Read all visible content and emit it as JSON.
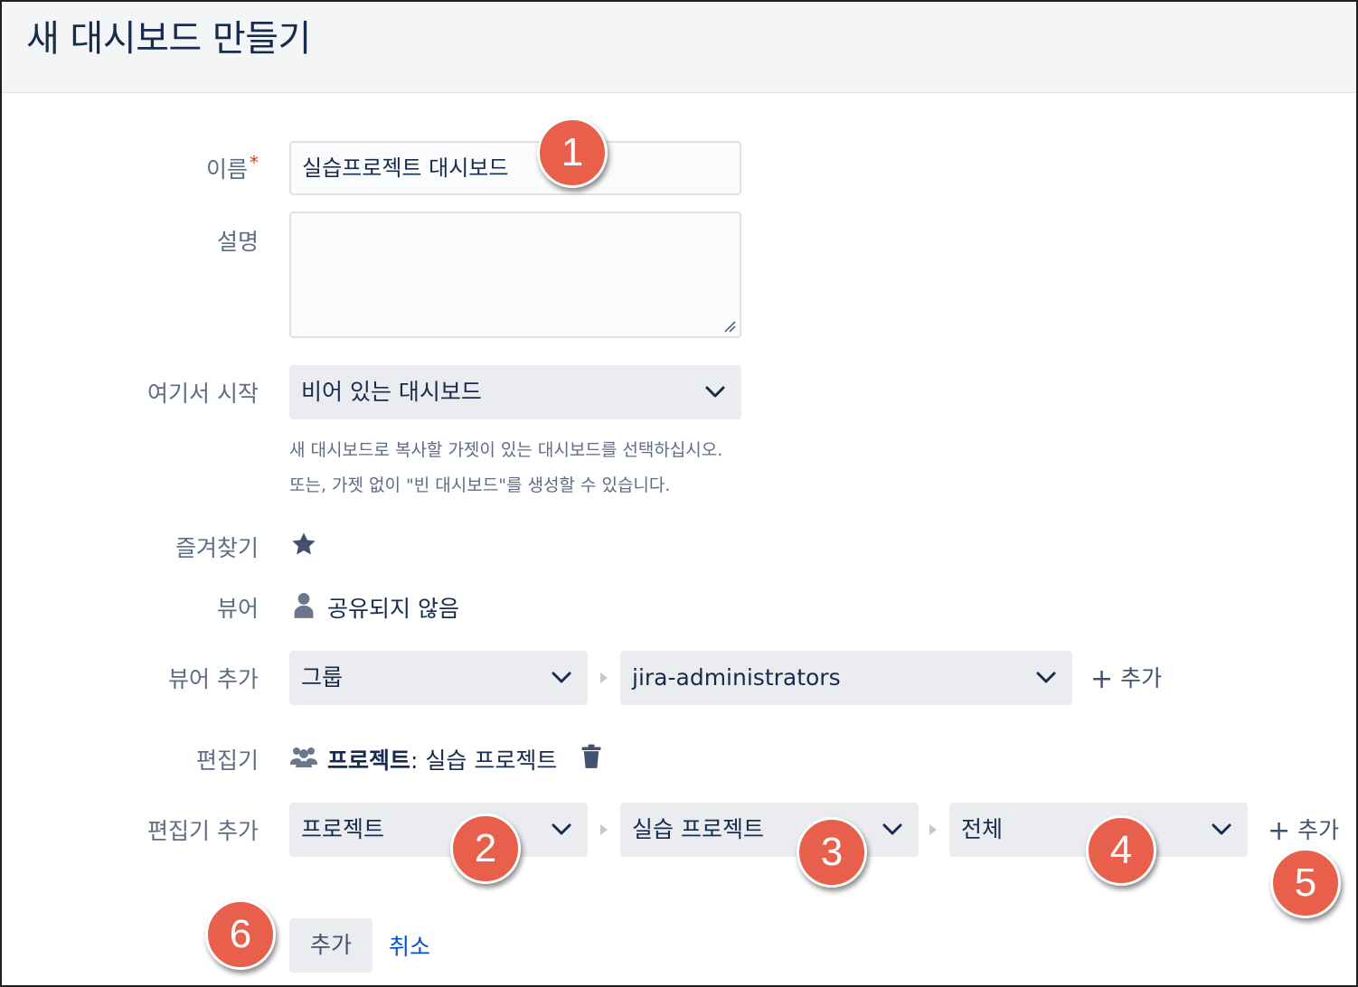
{
  "header": {
    "title": "새 대시보드 만들기"
  },
  "form": {
    "name": {
      "label": "이름",
      "required_mark": "*",
      "value": "실습프로젝트 대시보드"
    },
    "description": {
      "label": "설명",
      "value": ""
    },
    "start_from": {
      "label": "여기서 시작",
      "selected": "비어 있는 대시보드",
      "help_line1": "새 대시보드로 복사할 가젯이 있는 대시보드를 선택하십시오.",
      "help_line2": "또는, 가젯 없이 \"빈 대시보드\"를 생성할 수 있습니다."
    },
    "favorite": {
      "label": "즐겨찾기",
      "icon": "star-icon"
    },
    "viewers": {
      "label": "뷰어",
      "icon": "person-icon",
      "value": "공유되지 않음"
    },
    "add_viewer": {
      "label": "뷰어 추가",
      "type_selected": "그룹",
      "target_selected": "jira-administrators",
      "add_label": "추가"
    },
    "editors": {
      "label": "편집기",
      "icon": "group-icon",
      "type": "프로젝트",
      "separator": ":",
      "value": "실습 프로젝트",
      "delete_icon": "trash-icon"
    },
    "add_editor": {
      "label": "편집기 추가",
      "type_selected": "프로젝트",
      "project_selected": "실습 프로젝트",
      "role_selected": "전체",
      "add_label": "추가"
    }
  },
  "actions": {
    "submit_label": "추가",
    "cancel_label": "취소"
  },
  "badges": [
    "1",
    "2",
    "3",
    "4",
    "5",
    "6"
  ],
  "colors": {
    "badge": "#e8604c",
    "link": "#0052cc",
    "select_bg": "#ebecf0",
    "required": "#de350b"
  }
}
